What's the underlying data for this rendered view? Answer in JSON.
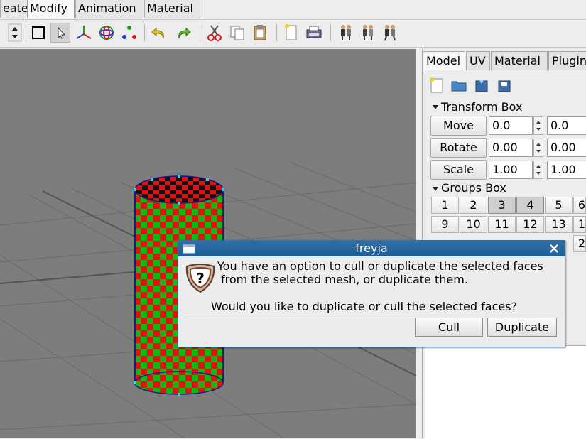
{
  "menubar": {
    "items": [
      {
        "label": "eate"
      },
      {
        "label": "Modify"
      },
      {
        "label": "Animation"
      },
      {
        "label": "Material"
      }
    ]
  },
  "toolbar": {
    "icons": [
      "spin-arrows-icon",
      "select-box-icon",
      "pointer-icon",
      "axis-move-icon",
      "rotate-rings-icon",
      "axis-scale-icon",
      "undo-icon",
      "redo-icon",
      "cut-icon",
      "copy-icon",
      "paste-icon",
      "new-page-icon",
      "print-icon",
      "figure-a-icon",
      "figure-b-icon",
      "figure-c-icon"
    ]
  },
  "panel": {
    "tabs": [
      "Model",
      "UV",
      "Material",
      "Plugin"
    ],
    "transform": {
      "header": "Transform Box",
      "rows": [
        {
          "label": "Move",
          "x": "0.0",
          "y": "0.0"
        },
        {
          "label": "Rotate",
          "x": "0.00",
          "y": "0.00"
        },
        {
          "label": "Scale",
          "x": "1.00",
          "y": "1.00"
        }
      ]
    },
    "groups": {
      "header": "Groups Box",
      "row1": [
        "1",
        "2",
        "3",
        "4",
        "5",
        "6"
      ],
      "row2": [
        "9",
        "10",
        "11",
        "12",
        "13",
        "1"
      ],
      "row3_edge": "2"
    }
  },
  "dialog": {
    "title": "freyja",
    "line1": "You have an option to cull or duplicate the selected faces",
    "line2": "from the selected mesh, or duplicate them.",
    "question": "Would you like to duplicate or cull the selected faces?",
    "cull_label": "Cull",
    "duplicate_label": "Duplicate"
  }
}
